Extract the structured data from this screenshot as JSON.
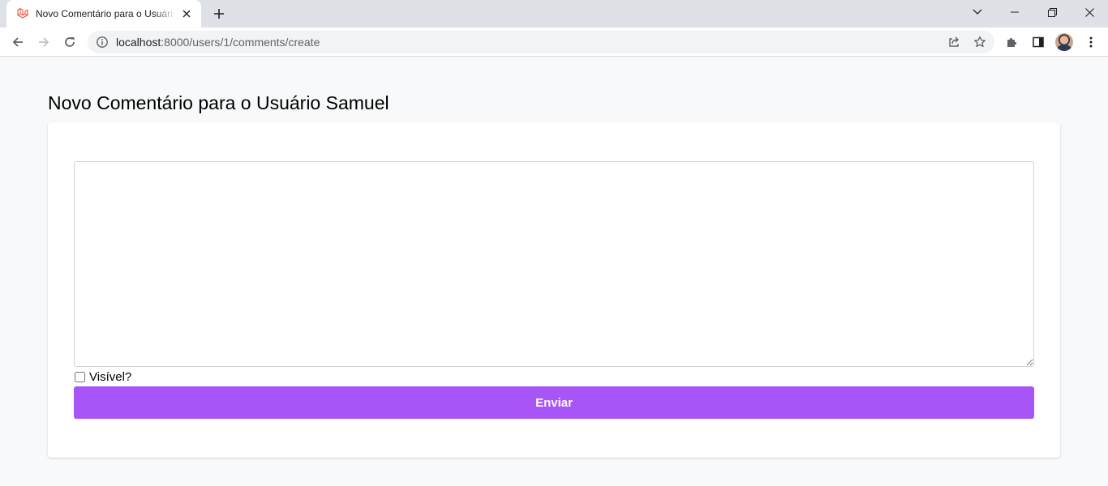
{
  "browser": {
    "tab_title": "Novo Comentário para o Usuário Samuel",
    "url_host": "localhost",
    "url_rest": ":8000/users/1/comments/create",
    "icons": {
      "favicon": "laravel-icon",
      "close": "close-icon",
      "new_tab": "plus-icon",
      "tab_search": "chevron-down-icon",
      "minimize": "minimize-icon",
      "restore": "restore-icon",
      "window_close": "close-icon",
      "back": "arrow-left-icon",
      "forward": "arrow-right-icon",
      "reload": "reload-icon",
      "site_info": "info-icon",
      "share": "share-icon",
      "bookmark": "star-icon",
      "extensions": "puzzle-icon",
      "side_panel": "side-panel-icon",
      "profile": "avatar",
      "menu": "kebab-menu-icon"
    }
  },
  "page": {
    "title": "Novo Comentário para o Usuário Samuel",
    "form": {
      "comment_value": "",
      "visible_label": "Visível?",
      "visible_checked": false,
      "submit_label": "Enviar"
    }
  },
  "colors": {
    "background": "#f8f9fa",
    "card": "#ffffff",
    "submit_button": "#a855f7",
    "favicon": "#f05340"
  }
}
